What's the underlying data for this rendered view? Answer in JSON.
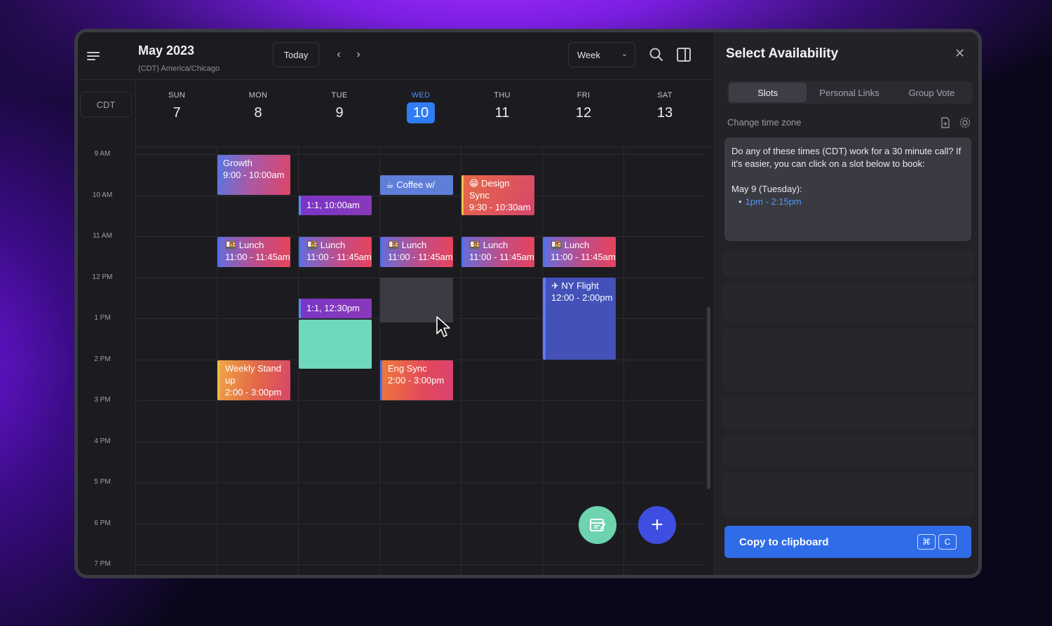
{
  "header": {
    "month_title": "May 2023",
    "timezone_sub": "(CDT) America/Chicago",
    "today_label": "Today",
    "prev_icon": "chevron-left-icon",
    "next_icon": "chevron-right-icon",
    "view_label": "Week"
  },
  "timezone_box": "CDT",
  "days": [
    {
      "name": "SUN",
      "num": "7"
    },
    {
      "name": "MON",
      "num": "8"
    },
    {
      "name": "TUE",
      "num": "9"
    },
    {
      "name": "WED",
      "num": "10",
      "today": true
    },
    {
      "name": "THU",
      "num": "11"
    },
    {
      "name": "FRI",
      "num": "12"
    },
    {
      "name": "SAT",
      "num": "13"
    }
  ],
  "hours": [
    "9 AM",
    "10 AM",
    "11 AM",
    "12 PM",
    "1 PM",
    "2 PM",
    "3 PM",
    "4 PM",
    "5 PM",
    "6 PM",
    "7 PM"
  ],
  "events": {
    "growth": {
      "title": "Growth",
      "time": "9:00 - 10:00am"
    },
    "one_on_one_tue_am": {
      "title": "1:1, 10:00am"
    },
    "coffee": {
      "title": "☕ Coffee w/"
    },
    "design_sync": {
      "title": "😁 Design",
      "title2": "Sync",
      "time": "9:30 - 10:30am"
    },
    "lunch_mon": {
      "title": "🍱 Lunch",
      "time": "11:00 - 11:45am"
    },
    "lunch_tue": {
      "title": "🍱 Lunch",
      "time": "11:00 - 11:45am"
    },
    "lunch_wed": {
      "title": "🍱 Lunch",
      "time": "11:00 - 11:45am"
    },
    "lunch_thu": {
      "title": "🍱 Lunch",
      "time": "11:00 - 11:45am"
    },
    "lunch_fri": {
      "title": "🍱 Lunch",
      "time": "11:00 - 11:45am"
    },
    "ny_flight": {
      "title": "✈ NY Flight",
      "time": "12:00 - 2:00pm"
    },
    "one_on_one_tue_pm": {
      "title": "1:1, 12:30pm"
    },
    "weekly_standup": {
      "title": "Weekly Stand",
      "title2": "up",
      "time": "2:00 - 3:00pm"
    },
    "eng_sync": {
      "title": "Eng Sync",
      "time": "2:00 - 3:00pm"
    }
  },
  "panel": {
    "title": "Select Availability",
    "tabs": [
      "Slots",
      "Personal Links",
      "Group Vote"
    ],
    "change_timezone": "Change time zone",
    "message": "Do any of these times (CDT) work for a 30 minute call? If it's easier, you can click on a slot below to book:",
    "message_date": "May 9 (Tuesday):",
    "message_slot": "1pm - 2:15pm",
    "copy_label": "Copy to clipboard",
    "shortcut_keys": [
      "⌘",
      "C"
    ]
  },
  "colors": {
    "accent_blue": "#2f7cf6",
    "fab_green": "#6ed4b0",
    "fab_blue": "#3e4ee0",
    "link_blue": "#4f95f5"
  }
}
